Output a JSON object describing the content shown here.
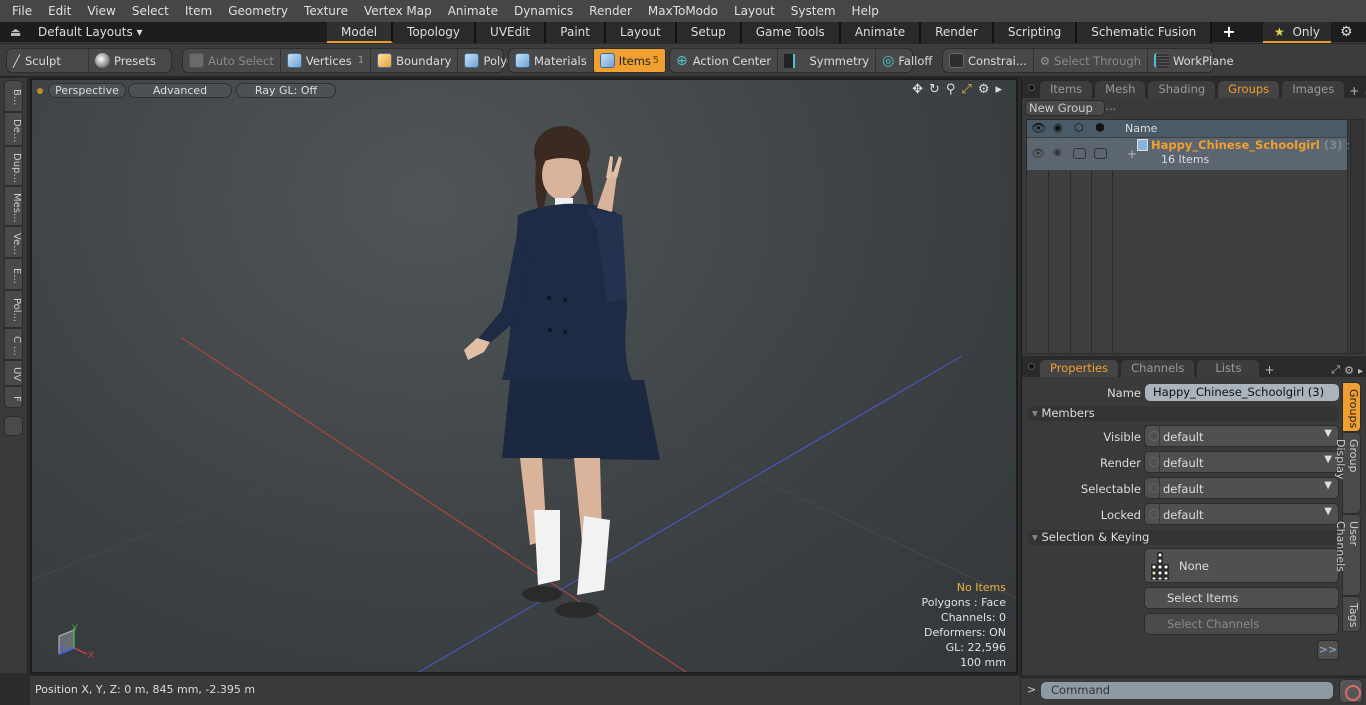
{
  "menubar": [
    "File",
    "Edit",
    "View",
    "Select",
    "Item",
    "Geometry",
    "Texture",
    "Vertex Map",
    "Animate",
    "Dynamics",
    "Render",
    "MaxToModo",
    "Layout",
    "System",
    "Help"
  ],
  "layoutbar": {
    "layouts_label": "Default Layouts",
    "tabs": [
      "Model",
      "Topology",
      "UVEdit",
      "Paint",
      "Layout",
      "Setup",
      "Game Tools",
      "Animate",
      "Render",
      "Scripting",
      "Schematic Fusion"
    ],
    "active_tab": "Model",
    "add_tab": "+",
    "only_label": "Only"
  },
  "toolbar": {
    "sculpt": "Sculpt",
    "presets": "Presets",
    "auto_select": "Auto Select",
    "vertices": "Vertices",
    "vertices_count": "1",
    "boundary": "Boundary",
    "polygons": "Polygons",
    "materials": "Materials",
    "items": "Items",
    "items_count": "5",
    "action_center": "Action Center",
    "symmetry": "Symmetry",
    "falloff": "Falloff",
    "constraints": "Constrai...",
    "select_through": "Select Through",
    "workplane": "WorkPlane"
  },
  "left_strip": [
    "B...",
    "De...",
    "Dup...",
    "Mes...",
    "Ve...",
    "E...",
    "Pol...",
    "C ...",
    "UV",
    "F ..."
  ],
  "viewport": {
    "view_mode": "Perspective",
    "shading": "Advanced",
    "raygl": "Ray GL: Off",
    "stats": {
      "selection": "No Items",
      "polygons": "Polygons : Face",
      "channels": "Channels: 0",
      "deformers": "Deformers: ON",
      "gl": "GL: 22,596",
      "scale": "100 mm"
    },
    "axis_labels": {
      "x": "X",
      "y": "Y",
      "z": "Z"
    }
  },
  "statusbar": {
    "position": "Position X, Y, Z:   0 m, 845 mm, -2.395 m"
  },
  "groups_panel": {
    "tabs": [
      "Items",
      "Mesh ...",
      "Shading",
      "Groups",
      "Images"
    ],
    "active_tab": "Groups",
    "new_group": "New Group",
    "column_name": "Name",
    "rows": [
      {
        "name": "Happy_Chinese_Schoolgirl",
        "count": "(3)",
        "suffix": ": ...",
        "items": "16 Items"
      }
    ]
  },
  "properties_panel": {
    "tabs": [
      "Properties",
      "Channels",
      "Lists"
    ],
    "active_tab": "Properties",
    "name_label": "Name",
    "name_value": "Happy_Chinese_Schoolgirl (3)",
    "members_section": "Members",
    "fields": [
      {
        "label": "Visible",
        "value": "default"
      },
      {
        "label": "Render",
        "value": "default"
      },
      {
        "label": "Selectable",
        "value": "default"
      },
      {
        "label": "Locked",
        "value": "default"
      }
    ],
    "selection_section": "Selection & Keying",
    "none_label": "None",
    "select_items": "Select Items",
    "select_channels": "Select Channels",
    "more": ">>",
    "side_tabs": [
      "Groups",
      "Group Display",
      "User Channels",
      "Tags"
    ],
    "active_side_tab": "Groups"
  },
  "command": {
    "prompt": ">",
    "placeholder": "Command"
  },
  "colors": {
    "accent": "#f0a030",
    "selection_text": "#f0b040"
  }
}
